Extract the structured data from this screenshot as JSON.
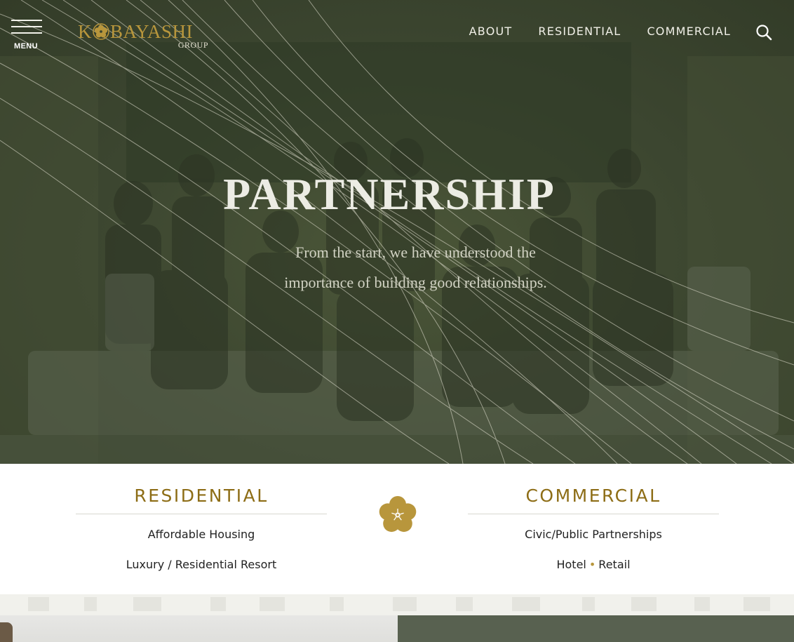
{
  "header": {
    "menu_label": "MENU",
    "logo": {
      "wordmark_first": "K",
      "wordmark_rest": "BAYASHI",
      "sub": "GROUP"
    },
    "nav": [
      "ABOUT",
      "RESIDENTIAL",
      "COMMERCIAL"
    ],
    "search_icon": "search-icon"
  },
  "hero": {
    "title": "PARTNERSHIP",
    "text": "From the start, we have understood the importance of building good relationships."
  },
  "categories": {
    "residential": {
      "title": "RESIDENTIAL",
      "links": [
        "Affordable Housing",
        "Luxury / Residential Resort"
      ]
    },
    "commercial": {
      "title": "COMMERCIAL",
      "links": [
        "Civic/Public Partnerships"
      ],
      "link2_a": "Hotel",
      "link2_b": "Retail",
      "separator": "•"
    }
  },
  "colors": {
    "gold": "#b8963c",
    "gold_dark": "#8d6d16",
    "hero_overlay": "#3c4630",
    "footer_panel": "#586150"
  }
}
